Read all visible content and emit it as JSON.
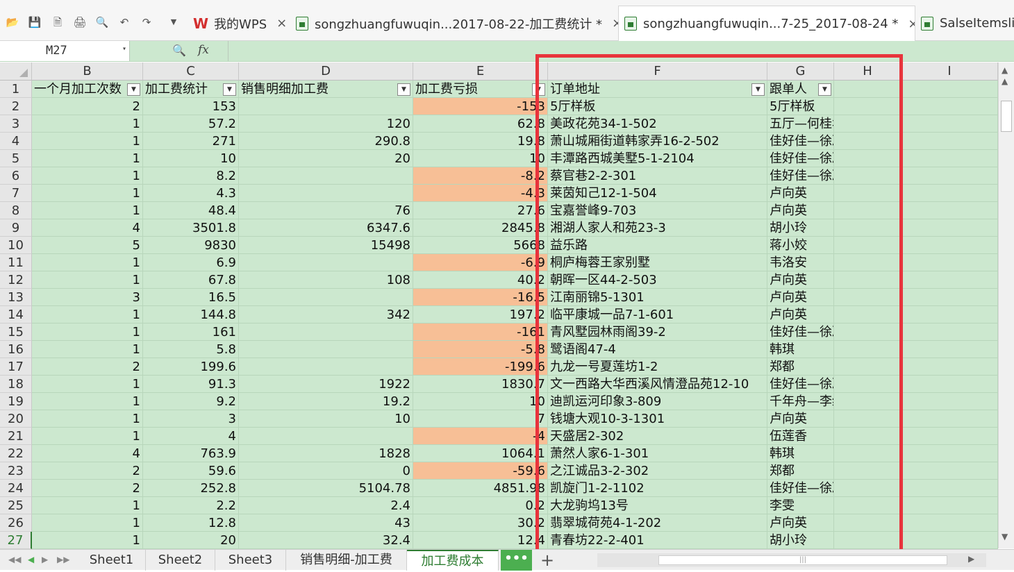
{
  "quick_access": [
    "open-folder-icon",
    "save-icon",
    "pdf-export-icon",
    "print-icon",
    "print-preview-icon",
    "undo-icon",
    "redo-icon",
    "dropdown-icon"
  ],
  "tabs": [
    {
      "label": "我的WPS",
      "type": "wps",
      "close": "×"
    },
    {
      "label": "songzhuangfuwuqin...2017-08-22-加工费统计 *",
      "type": "sheet",
      "close": "×"
    },
    {
      "label": "songzhuangfuwuqin...7-25_2017-08-24 *",
      "type": "sheet",
      "close": "×",
      "active": true
    },
    {
      "label": "SalseItemslis",
      "type": "sheet"
    }
  ],
  "wps_logo": "W",
  "formula_bar": {
    "name_box": "M27",
    "fx": "fx",
    "formula": ""
  },
  "columns": [
    "B",
    "C",
    "D",
    "E",
    "F",
    "G",
    "H",
    "I"
  ],
  "header_row": {
    "row": "1",
    "B": "一个月加工次数",
    "C": "加工费统计",
    "D": "销售明细加工费",
    "E": "加工费亏损",
    "F": "订单地址",
    "G": "跟单人"
  },
  "rows": [
    {
      "r": "2",
      "B": "2",
      "C": "153",
      "D": "",
      "E": "-153",
      "Eneg": true,
      "F": "5厅样板",
      "G": "5厅样板"
    },
    {
      "r": "3",
      "B": "1",
      "C": "57.2",
      "D": "120",
      "E": "62.8",
      "Eneg": false,
      "F": "美政花苑34-1-502",
      "G": "五厅—何桂华"
    },
    {
      "r": "4",
      "B": "1",
      "C": "271",
      "D": "290.8",
      "E": "19.8",
      "Eneg": false,
      "F": "萧山城厢街道韩家弄16-2-502",
      "G": "佳好佳—徐凌玲"
    },
    {
      "r": "5",
      "B": "1",
      "C": "10",
      "D": "20",
      "E": "10",
      "Eneg": false,
      "F": "丰潭路西城美墅5-1-2104",
      "G": "佳好佳—徐凌玲"
    },
    {
      "r": "6",
      "B": "1",
      "C": "8.2",
      "D": "",
      "E": "-8.2",
      "Eneg": true,
      "F": "蔡官巷2-2-301",
      "G": "佳好佳—徐凌玲"
    },
    {
      "r": "7",
      "B": "1",
      "C": "4.3",
      "D": "",
      "E": "-4.3",
      "Eneg": true,
      "F": "莱茵知己12-1-504",
      "G": "卢向英"
    },
    {
      "r": "8",
      "B": "1",
      "C": "48.4",
      "D": "76",
      "E": "27.6",
      "Eneg": false,
      "F": "宝嘉誉峰9-703",
      "G": "卢向英"
    },
    {
      "r": "9",
      "B": "4",
      "C": "3501.8",
      "D": "6347.6",
      "E": "2845.8",
      "Eneg": false,
      "F": "湘湖人家人和苑23-3",
      "G": "胡小玲"
    },
    {
      "r": "10",
      "B": "5",
      "C": "9830",
      "D": "15498",
      "E": "5668",
      "Eneg": false,
      "F": "益乐路",
      "G": "蒋小姣"
    },
    {
      "r": "11",
      "B": "1",
      "C": "6.9",
      "D": "",
      "E": "-6.9",
      "Eneg": true,
      "F": "桐庐梅蓉王家别墅",
      "G": "韦洛安"
    },
    {
      "r": "12",
      "B": "1",
      "C": "67.8",
      "D": "108",
      "E": "40.2",
      "Eneg": false,
      "F": "朝晖一区44-2-503",
      "G": "卢向英"
    },
    {
      "r": "13",
      "B": "3",
      "C": "16.5",
      "D": "",
      "E": "-16.5",
      "Eneg": true,
      "F": "江南丽锦5-1301",
      "G": "卢向英"
    },
    {
      "r": "14",
      "B": "1",
      "C": "144.8",
      "D": "342",
      "E": "197.2",
      "Eneg": false,
      "F": "临平康城一品7-1-601",
      "G": "卢向英"
    },
    {
      "r": "15",
      "B": "1",
      "C": "161",
      "D": "",
      "E": "-161",
      "Eneg": true,
      "F": "青风墅园林雨阁39-2",
      "G": "佳好佳—徐凌玲"
    },
    {
      "r": "16",
      "B": "1",
      "C": "5.8",
      "D": "",
      "E": "-5.8",
      "Eneg": true,
      "F": "鹭语阁47-4",
      "G": " 韩琪"
    },
    {
      "r": "17",
      "B": "2",
      "C": "199.6",
      "D": "",
      "E": "-199.6",
      "Eneg": true,
      "F": "九龙一号夏莲坊1-2",
      "G": "郑都"
    },
    {
      "r": "18",
      "B": "1",
      "C": "91.3",
      "D": "1922",
      "E": "1830.7",
      "Eneg": false,
      "F": "文一西路大华西溪风情澄品苑12-10",
      "G": "佳好佳—徐凌玲"
    },
    {
      "r": "19",
      "B": "1",
      "C": "9.2",
      "D": "19.2",
      "E": "10",
      "Eneg": false,
      "F": "迪凯运河印象3-809",
      "G": "千年舟—李绍敏"
    },
    {
      "r": "20",
      "B": "1",
      "C": "3",
      "D": "10",
      "E": "7",
      "Eneg": false,
      "F": "钱塘大观10-3-1301",
      "G": "卢向英"
    },
    {
      "r": "21",
      "B": "1",
      "C": "4",
      "D": "",
      "E": "-4",
      "Eneg": true,
      "F": "天盛居2-302",
      "G": "伍莲香"
    },
    {
      "r": "22",
      "B": "4",
      "C": "763.9",
      "D": "1828",
      "E": "1064.1",
      "Eneg": false,
      "F": "萧然人家6-1-301",
      "G": " 韩琪"
    },
    {
      "r": "23",
      "B": "2",
      "C": "59.6",
      "D": "0",
      "E": "-59.6",
      "Eneg": true,
      "F": "之江诚品3-2-302",
      "G": "郑都"
    },
    {
      "r": "24",
      "B": "2",
      "C": "252.8",
      "D": "5104.78",
      "E": "4851.98",
      "Eneg": false,
      "F": "凯旋门1-2-1102",
      "G": "佳好佳—徐凌玲"
    },
    {
      "r": "25",
      "B": "1",
      "C": "2.2",
      "D": "2.4",
      "E": "0.2",
      "Eneg": false,
      "F": "大龙驹坞13号",
      "G": "李雯"
    },
    {
      "r": "26",
      "B": "1",
      "C": "12.8",
      "D": "43",
      "E": "30.2",
      "Eneg": false,
      "F": "翡翠城荷苑4-1-202",
      "G": "卢向英"
    },
    {
      "r": "27",
      "B": "1",
      "C": "20",
      "D": "32.4",
      "E": "12.4",
      "Eneg": false,
      "F": "青春坊22-2-401",
      "G": "胡小玲"
    }
  ],
  "sheet_tabs": [
    {
      "label": "Sheet1",
      "active": false
    },
    {
      "label": "Sheet2",
      "active": false
    },
    {
      "label": "Sheet3",
      "active": false
    },
    {
      "label": "销售明细-加工费",
      "active": false
    },
    {
      "label": "加工费成本",
      "active": true
    }
  ],
  "sheet_more": "•••",
  "sheet_add": "+",
  "colors": {
    "cell_bg": "#cce8cf",
    "negative_bg": "#f7bf96",
    "highlight_border": "#e8343c",
    "active_accent": "#2e7d32"
  }
}
